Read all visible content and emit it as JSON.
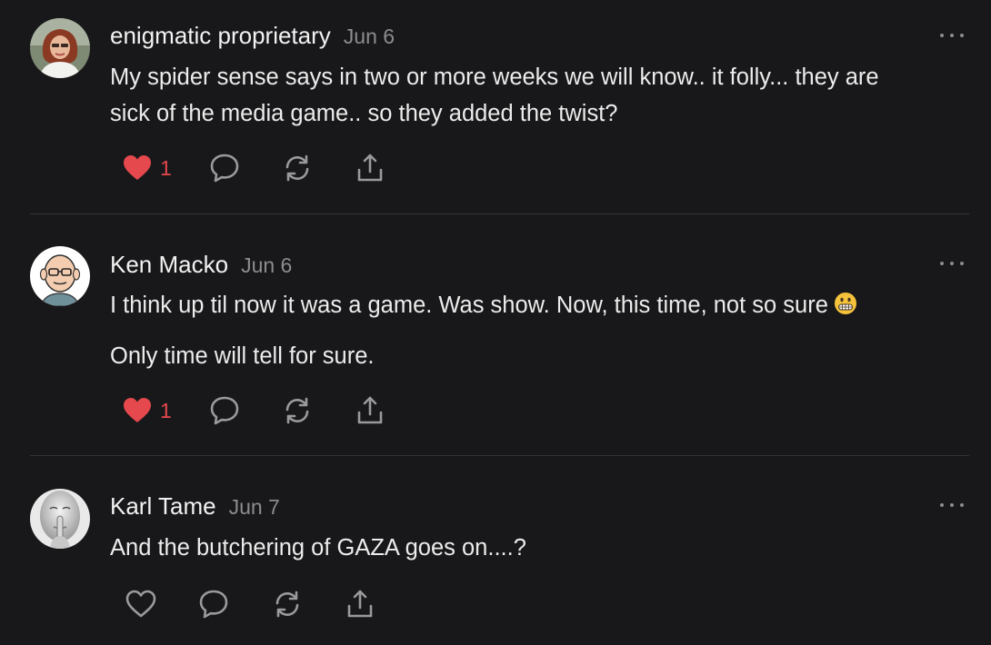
{
  "comments": [
    {
      "author": "enigmatic proprietary",
      "date": "Jun 6",
      "lines": [
        "My spider sense says in two or more weeks we will know.. it folly... they are",
        "sick of the media game.. so they added the twist?"
      ],
      "liked": true,
      "like_count": "1",
      "avatar_icon": "woman-photo-avatar"
    },
    {
      "author": "Ken Macko",
      "date": "Jun 6",
      "lines": [
        "I think up til now it was a game. Was show. Now, this time, not so sure",
        "Only time will tell for sure."
      ],
      "emoji": "grimacing-face",
      "liked": true,
      "like_count": "1",
      "avatar_icon": "cartoon-man-avatar"
    },
    {
      "author": "Karl Tame",
      "date": "Jun 7",
      "lines": [
        "And the butchering of GAZA goes on....?"
      ],
      "liked": false,
      "like_count": "",
      "avatar_icon": "shush-face-avatar"
    }
  ],
  "icons": {
    "like": "heart-icon",
    "reply": "speech-bubble-icon",
    "restack": "restack-arrows-icon",
    "share": "share-icon",
    "more": "ellipsis-icon"
  },
  "colors": {
    "background": "#18181a",
    "liked": "#e5484d",
    "muted": "#8c8c8e",
    "text": "#ececec"
  }
}
